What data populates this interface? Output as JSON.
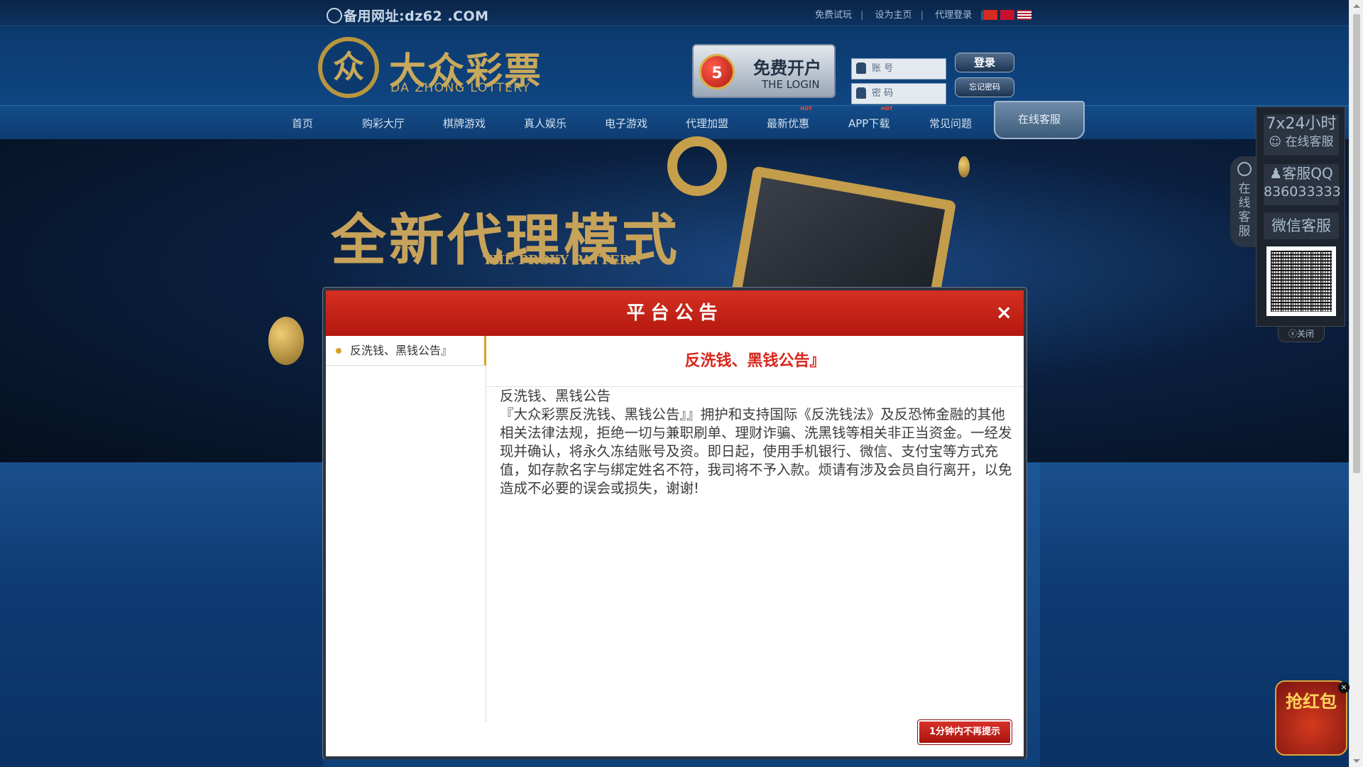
{
  "topbar": {
    "backup_url": "备用网址:dz62 .COM",
    "links": [
      "免费试玩",
      "设为主页",
      "代理登录"
    ]
  },
  "logo": {
    "cn": "大众彩票",
    "en": "DA ZHONG LOTTERY",
    "mark": "众"
  },
  "free_open": {
    "ball": "5",
    "title": "免费开户",
    "sub": "THE LOGIN"
  },
  "login": {
    "account_placeholder": "账 号",
    "password_placeholder": "密 码",
    "login_button": "登录",
    "forgot_button": "忘记密码"
  },
  "nav": {
    "items": [
      "首页",
      "购彩大厅",
      "棋牌游戏",
      "真人娱乐",
      "电子游戏",
      "代理加盟",
      "最新优惠",
      "APP下载",
      "常见问题"
    ],
    "hot_label": "HOT",
    "service": "在线客服"
  },
  "banner": {
    "title": "全新代理模式",
    "subtitle": "THE PROXY PATTERN"
  },
  "side_panel": {
    "tab": "在线客服",
    "hours": "7x24小时",
    "online_service": "在线客服",
    "qq_label": "客服QQ",
    "qq_number": "836033333",
    "wechat": "微信客服",
    "close": "关闭"
  },
  "redpacket": {
    "label": "抢红包"
  },
  "modal": {
    "title": "平台公告",
    "close": "×",
    "side_items": [
      "反洗钱、黑钱公告』"
    ],
    "article_title": "反洗钱、黑钱公告』",
    "article_heading": "反洗钱、黑钱公告",
    "article_body": "『大众彩票反洗钱、黑钱公告』』拥护和支持国际《反洗钱法》及反恐怖金融的其他相关法律法规，拒绝一切与兼职刷单、理财诈骗、洗黑钱等相关非正当资金。一经发现并确认，将永久冻结账号及资。即日起，使用手机银行、微信、支付宝等方式充值，如存款名字与绑定姓名不符，我司将不予入款。烦请有涉及会员自行离开，以免造成不必要的误会或损失，谢谢!",
    "dismiss_button": "1分钟内不再提示"
  }
}
